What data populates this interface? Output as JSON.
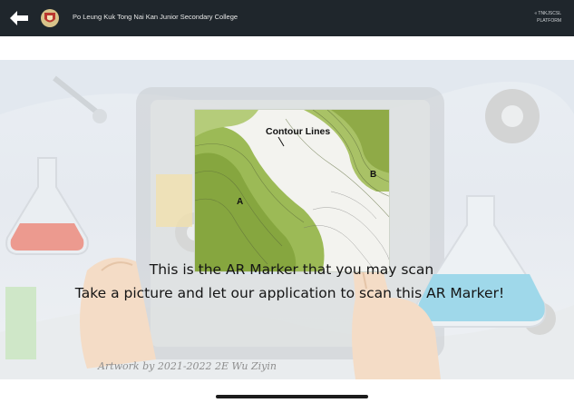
{
  "header": {
    "school_name": "Po Leung Kuk Tong Nai Kan Junior Secondary College",
    "brand_line1": "« TNKJSCSL",
    "brand_line2": "PLATFORM"
  },
  "marker": {
    "title": "Contour Lines",
    "point_a": "A",
    "point_b": "B"
  },
  "captions": {
    "line1": "This is the AR Marker that you may scan",
    "line2": "Take a picture and let our application to scan this AR Marker!"
  },
  "credit": "Artwork by 2021-2022 2E Wu Ziyin",
  "icons": {
    "back": "back-arrow-icon",
    "logo": "school-crest-icon"
  },
  "colors": {
    "topbar": "#1f262c",
    "map_green": "#8fb04a",
    "text": "#151515"
  }
}
